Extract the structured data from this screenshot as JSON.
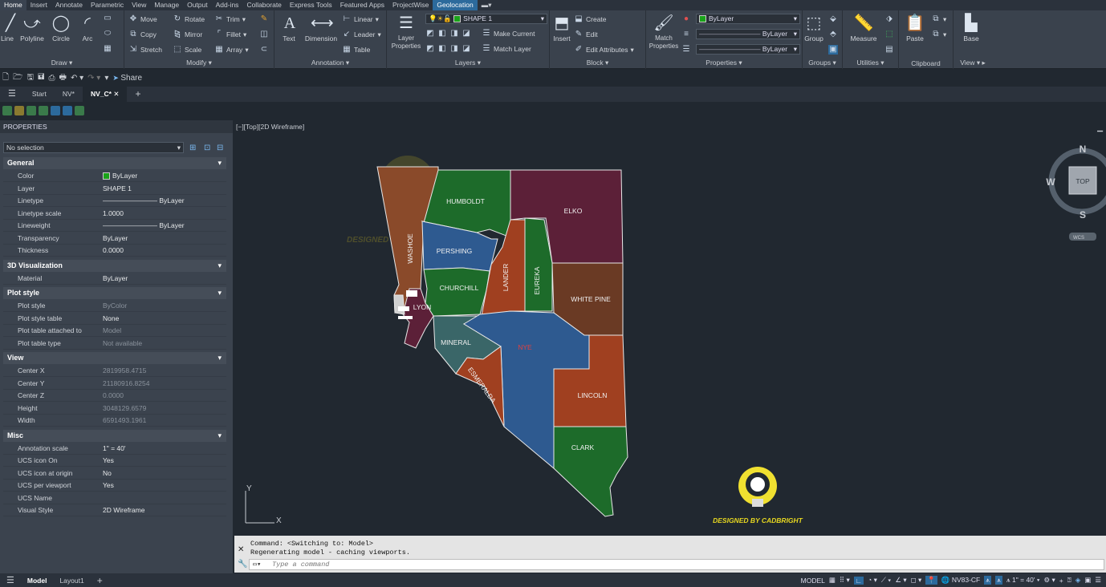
{
  "menu_tabs": [
    "Home",
    "Insert",
    "Annotate",
    "Parametric",
    "View",
    "Manage",
    "Output",
    "Add-ins",
    "Collaborate",
    "Express Tools",
    "Featured Apps",
    "ProjectWise",
    "Geolocation"
  ],
  "ribbon": {
    "draw": {
      "title": "Draw",
      "line": "Line",
      "polyline": "Polyline",
      "circle": "Circle",
      "arc": "Arc"
    },
    "modify": {
      "title": "Modify",
      "move": "Move",
      "rotate": "Rotate",
      "trim": "Trim",
      "copy": "Copy",
      "mirror": "Mirror",
      "fillet": "Fillet",
      "stretch": "Stretch",
      "scale": "Scale",
      "array": "Array"
    },
    "annotation": {
      "title": "Annotation",
      "text": "Text",
      "dimension": "Dimension",
      "linear": "Linear",
      "leader": "Leader",
      "table": "Table"
    },
    "layers": {
      "title": "Layers",
      "layer_properties": "Layer Properties",
      "current_layer": "SHAPE 1",
      "make_current": "Make Current",
      "match_layer": "Match Layer"
    },
    "block": {
      "title": "Block",
      "insert": "Insert",
      "create": "Create",
      "edit": "Edit",
      "edit_attributes": "Edit Attributes"
    },
    "properties": {
      "title": "Properties",
      "match_properties": "Match Properties",
      "color": "ByLayer",
      "linetype": "ByLayer",
      "lineweight": "ByLayer"
    },
    "groups": {
      "title": "Groups",
      "group": "Group"
    },
    "utilities": {
      "title": "Utilities",
      "measure": "Measure"
    },
    "clipboard": {
      "title": "Clipboard",
      "paste": "Paste"
    },
    "view": {
      "title": "View",
      "base": "Base"
    }
  },
  "qat": {
    "share": "Share"
  },
  "file_tabs": [
    "Start",
    "NV*",
    "NV_C*"
  ],
  "properties_panel": {
    "title": "PROPERTIES",
    "selection": "No selection",
    "sections": [
      {
        "name": "General",
        "rows": [
          [
            "Color",
            "ByLayer"
          ],
          [
            "Layer",
            "SHAPE 1"
          ],
          [
            "Linetype",
            "———————— ByLayer"
          ],
          [
            "Linetype scale",
            "1.0000"
          ],
          [
            "Lineweight",
            "———————— ByLayer"
          ],
          [
            "Transparency",
            "ByLayer"
          ],
          [
            "Thickness",
            "0.0000"
          ]
        ]
      },
      {
        "name": "3D Visualization",
        "rows": [
          [
            "Material",
            "ByLayer"
          ]
        ]
      },
      {
        "name": "Plot style",
        "rows": [
          [
            "Plot style",
            "ByColor"
          ],
          [
            "Plot style table",
            "None"
          ],
          [
            "Plot table attached to",
            "Model"
          ],
          [
            "Plot table type",
            "Not available"
          ]
        ]
      },
      {
        "name": "View",
        "rows": [
          [
            "Center X",
            "2819958.4715"
          ],
          [
            "Center Y",
            "21180916.8254"
          ],
          [
            "Center Z",
            "0.0000"
          ],
          [
            "Height",
            "3048129.6579"
          ],
          [
            "Width",
            "6591493.1961"
          ]
        ]
      },
      {
        "name": "Misc",
        "rows": [
          [
            "Annotation scale",
            "1\" = 40'"
          ],
          [
            "UCS icon On",
            "Yes"
          ],
          [
            "UCS icon at origin",
            "No"
          ],
          [
            "UCS per viewport",
            "Yes"
          ],
          [
            "UCS Name",
            ""
          ],
          [
            "Visual Style",
            "2D Wireframe"
          ]
        ]
      }
    ]
  },
  "viewport": {
    "label": "[−][Top][2D Wireframe]",
    "viewcube": {
      "n": "N",
      "s": "S",
      "w": "W",
      "top": "TOP",
      "wcs": "WCS"
    },
    "ucs": {
      "x": "X",
      "y": "Y"
    },
    "watermark": "DESIGNED BY CADBRIGHT",
    "counties": [
      "HUMBOLDT",
      "ELKO",
      "WASHOE",
      "PERSHING",
      "CHURCHILL",
      "LANDER",
      "EUREKA",
      "WHITE PINE",
      "LYON",
      "MINERAL",
      "NYE",
      "ESMERALDA",
      "LINCOLN",
      "CLARK"
    ]
  },
  "command": {
    "line1": "Command:   <Switching to: Model>",
    "line2": "Regenerating model - caching viewports.",
    "placeholder": "Type a command"
  },
  "status": {
    "model_tab": "Model",
    "layout_tab": "Layout1",
    "model": "MODEL",
    "coord_system": "NV83-CF",
    "scale": "1\" = 40'"
  }
}
